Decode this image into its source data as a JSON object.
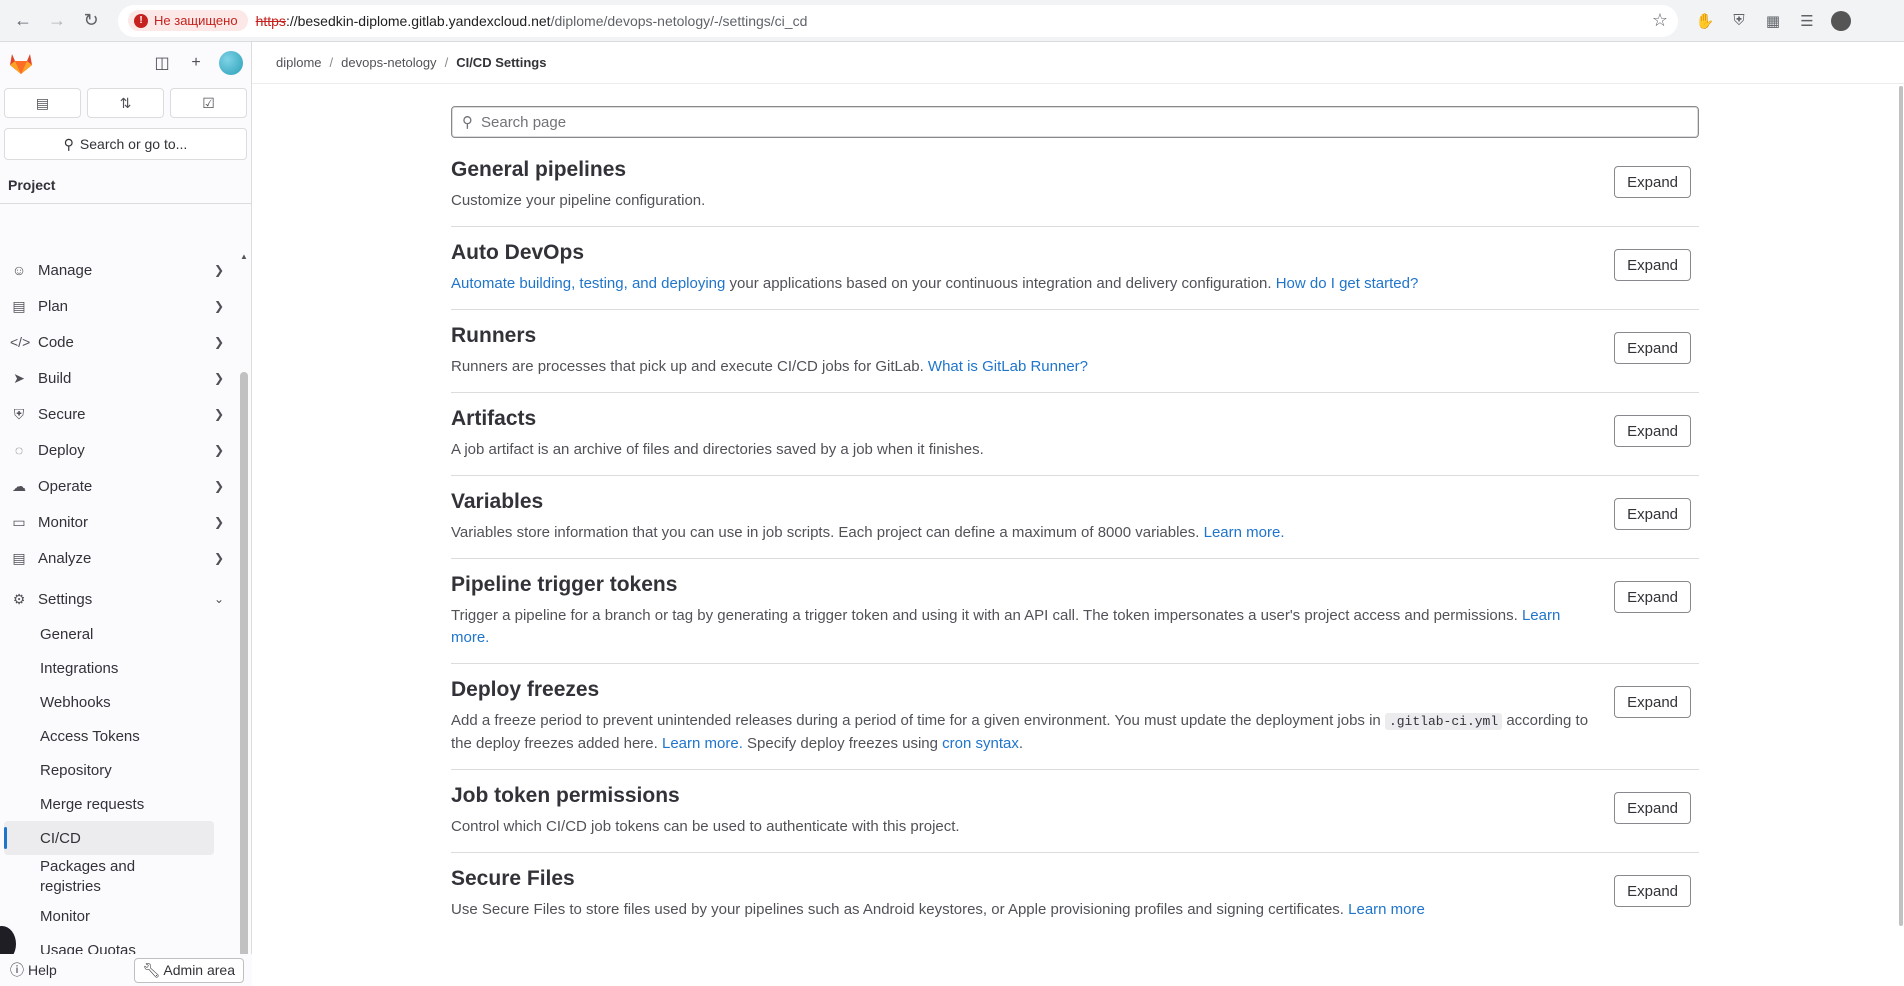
{
  "browser": {
    "security_label": "Не защищено",
    "url_scheme": "https",
    "url_host": "://besedkin-diplome.gitlab.yandexcloud.net",
    "url_path": "/diplome/devops-netology/-/settings/ci_cd"
  },
  "sidebar": {
    "search_label": "Search or go to...",
    "section_title": "Project",
    "items": [
      {
        "label": "Manage",
        "icon": "users-icon"
      },
      {
        "label": "Plan",
        "icon": "calendar-icon"
      },
      {
        "label": "Code",
        "icon": "code-icon"
      },
      {
        "label": "Build",
        "icon": "rocket-icon"
      },
      {
        "label": "Secure",
        "icon": "shield-icon"
      },
      {
        "label": "Deploy",
        "icon": "deploy-icon"
      },
      {
        "label": "Operate",
        "icon": "cloud-icon"
      },
      {
        "label": "Monitor",
        "icon": "monitor-icon"
      },
      {
        "label": "Analyze",
        "icon": "chart-icon"
      },
      {
        "label": "Settings",
        "icon": "gear-icon"
      }
    ],
    "settings_subitems": [
      "General",
      "Integrations",
      "Webhooks",
      "Access Tokens",
      "Repository",
      "Merge requests",
      "CI/CD",
      "Packages and registries",
      "Monitor",
      "Usage Quotas"
    ],
    "help_label": "Help",
    "admin_label": "Admin area"
  },
  "breadcrumb": {
    "items": [
      "diplome",
      "devops-netology",
      "CI/CD Settings"
    ]
  },
  "search": {
    "placeholder": "Search page"
  },
  "expand_label": "Expand",
  "sections": [
    {
      "title": "General pipelines",
      "description": "Customize your pipeline configuration."
    },
    {
      "title": "Auto DevOps",
      "link1": "Automate building, testing, and deploying",
      "description": " your applications based on your continuous integration and delivery configuration. ",
      "link2": "How do I get started?"
    },
    {
      "title": "Runners",
      "description": "Runners are processes that pick up and execute CI/CD jobs for GitLab. ",
      "link": "What is GitLab Runner?"
    },
    {
      "title": "Artifacts",
      "description": "A job artifact is an archive of files and directories saved by a job when it finishes."
    },
    {
      "title": "Variables",
      "description": "Variables store information that you can use in job scripts. Each project can define a maximum of 8000 variables. ",
      "link": "Learn more."
    },
    {
      "title": "Pipeline trigger tokens",
      "description": "Trigger a pipeline for a branch or tag by generating a trigger token and using it with an API call. The token impersonates a user's project access and permissions. ",
      "link": "Learn more."
    },
    {
      "title": "Deploy freezes",
      "description_a": "Add a freeze period to prevent unintended releases during a period of time for a given environment. You must update the deployment jobs in ",
      "code": ".gitlab-ci.yml",
      "description_b": " according to the deploy freezes added here. ",
      "link1": "Learn more.",
      "description_c": " Specify deploy freezes using ",
      "link2": "cron syntax",
      "description_d": "."
    },
    {
      "title": "Job token permissions",
      "description": "Control which CI/CD job tokens can be used to authenticate with this project."
    },
    {
      "title": "Secure Files",
      "description": "Use Secure Files to store files used by your pipelines such as Android keystores, or Apple provisioning profiles and signing certificates. ",
      "link": "Learn more"
    }
  ]
}
